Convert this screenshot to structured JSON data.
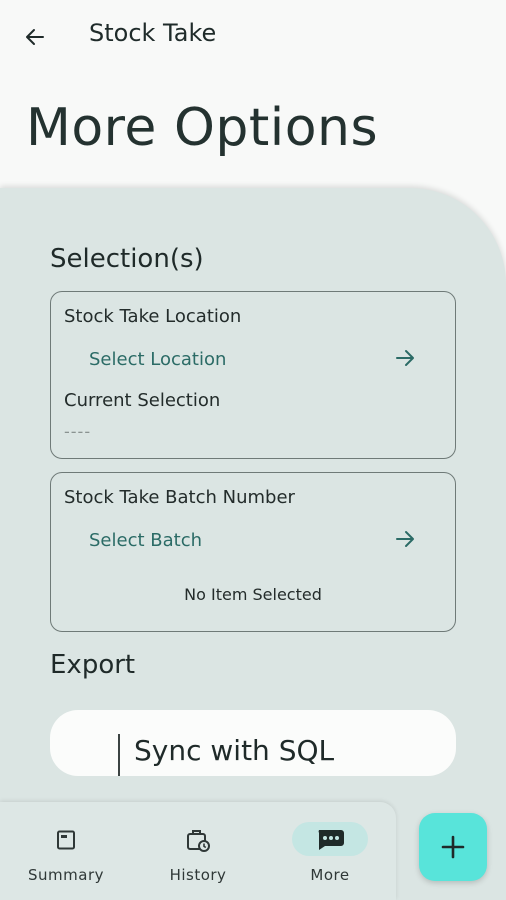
{
  "topbar": {
    "title": "Stock Take"
  },
  "page": {
    "title": "More Options"
  },
  "selection": {
    "heading": "Selection(s)",
    "location_card": {
      "label": "Stock Take Location",
      "select_text": "Select Location",
      "current_label": "Current Selection",
      "current_value": "----"
    },
    "batch_card": {
      "label": "Stock Take Batch Number",
      "select_text": "Select Batch",
      "status": "No Item Selected"
    }
  },
  "export": {
    "heading": "Export",
    "sync_label": "Sync with SQL"
  },
  "bottom_nav": {
    "items": [
      {
        "label": "Summary",
        "icon": "summary-icon"
      },
      {
        "label": "History",
        "icon": "history-icon"
      },
      {
        "label": "More",
        "icon": "more-icon",
        "active": true
      }
    ]
  },
  "fab": {
    "icon": "plus-icon"
  },
  "colors": {
    "accent": "#58e4da",
    "panel": "#dbe5e3",
    "link": "#2b6b66",
    "active_pill": "#c4e6e3"
  }
}
